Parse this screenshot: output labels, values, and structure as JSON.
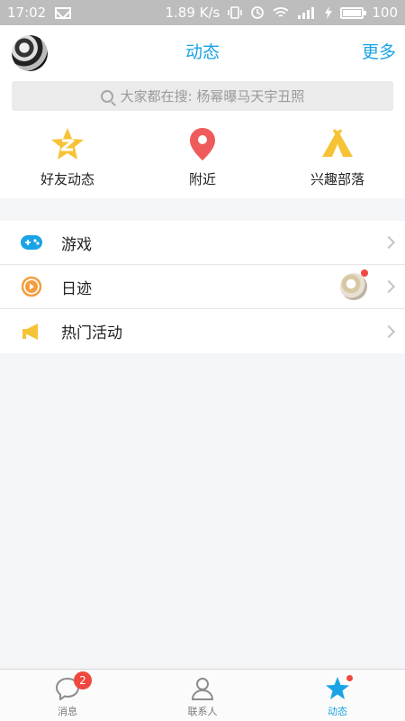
{
  "status_bar": {
    "time": "17:02",
    "net_speed": "1.89 K/s",
    "battery": "100"
  },
  "header": {
    "title": "动态",
    "more": "更多"
  },
  "search": {
    "placeholder": "大家都在搜: 杨幂曝马天宇丑照"
  },
  "quick_entries": [
    {
      "label": "好友动态",
      "icon": "star-z-icon"
    },
    {
      "label": "附近",
      "icon": "location-pin-icon"
    },
    {
      "label": "兴趣部落",
      "icon": "tent-icon"
    }
  ],
  "list": [
    {
      "label": "游戏",
      "icon": "gamepad-icon"
    },
    {
      "label": "日迹",
      "icon": "play-circle-icon"
    },
    {
      "label": "热门活动",
      "icon": "megaphone-icon"
    }
  ],
  "tabs": [
    {
      "label": "消息",
      "icon": "chat-icon",
      "badge": "2"
    },
    {
      "label": "联系人",
      "icon": "contacts-icon"
    },
    {
      "label": "动态",
      "icon": "star-icon",
      "active": true
    }
  ],
  "colors": {
    "accent": "#1aa3e6",
    "badge": "#f0483e",
    "star": "#f6c337",
    "pin": "#ef5a5a"
  }
}
